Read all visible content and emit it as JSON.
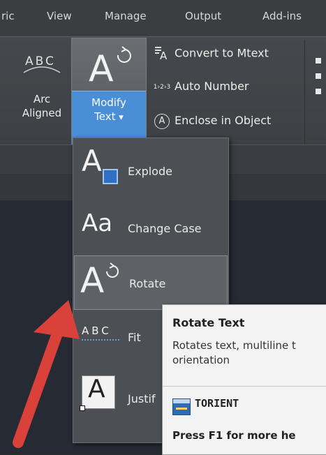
{
  "tabs": [
    "ric",
    "View",
    "Manage",
    "Output",
    "Add-ins"
  ],
  "ribbon": {
    "arc_aligned": {
      "icon_text": "ABC",
      "label_line1": "Arc",
      "label_line2": "Aligned"
    },
    "modify_text": {
      "label_line1": "Modify",
      "label_line2": "Text",
      "dropdown": "▾"
    },
    "small_buttons": [
      {
        "icon": "convert-to-mtext-icon",
        "label": "Convert to Mtext"
      },
      {
        "icon": "auto-number-icon",
        "icon_text": "1›2›3",
        "label": "Auto Number"
      },
      {
        "icon": "enclose-icon",
        "icon_text": "A",
        "label": "Enclose in Object"
      }
    ]
  },
  "menu": {
    "items": [
      {
        "icon": "explode-text-icon",
        "label": "Explode"
      },
      {
        "icon": "change-case-icon",
        "icon_text": "Aa",
        "label": "Change Case"
      },
      {
        "icon": "rotate-text-icon",
        "label": "Rotate"
      },
      {
        "icon": "fit-text-icon",
        "icon_text": "ABC",
        "label": "Fit"
      },
      {
        "icon": "justify-text-icon",
        "label": "Justif"
      }
    ]
  },
  "tooltip": {
    "title": "Rotate Text",
    "description": "Rotates text, multiline t\norientation",
    "command": "TORIENT",
    "help": "Press F1 for more he"
  },
  "colors": {
    "accent": "#4a8fd6",
    "arrow": "#d9413a"
  }
}
